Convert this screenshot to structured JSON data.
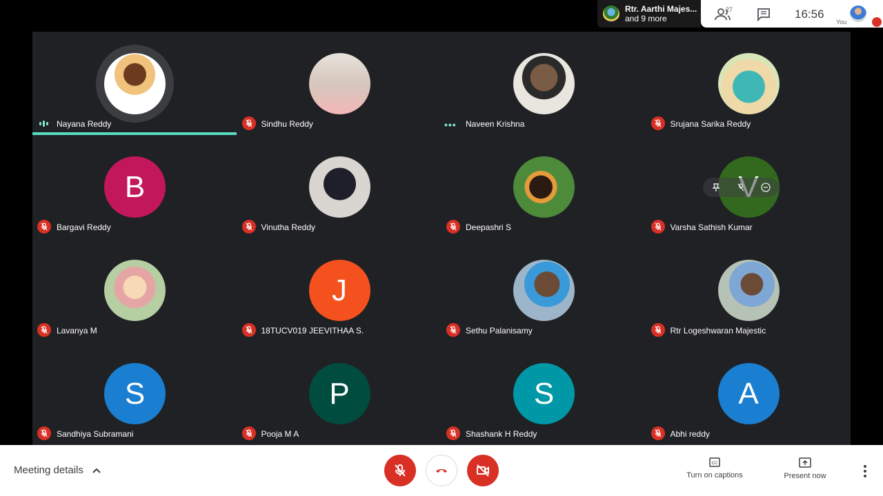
{
  "topbar": {
    "presenter_name": "Rtr. Aarthi Majes...",
    "presenter_more": "and 9 more",
    "people_count": "27",
    "clock": "16:56",
    "self_label": "You"
  },
  "participants": [
    {
      "name": "Nayana Reddy",
      "avatar": "photo",
      "status": "speaking"
    },
    {
      "name": "Sindhu Reddy",
      "avatar": "photo",
      "status": "muted"
    },
    {
      "name": "Naveen Krishna",
      "avatar": "photo",
      "status": "dots"
    },
    {
      "name": "Srujana Sarika Reddy",
      "avatar": "photo",
      "status": "muted"
    },
    {
      "name": "Bargavi Reddy",
      "avatar": "letter",
      "letter": "B",
      "color": "#c2185b",
      "status": "muted"
    },
    {
      "name": "Vinutha Reddy",
      "avatar": "photo",
      "status": "muted"
    },
    {
      "name": "Deepashri S",
      "avatar": "photo",
      "status": "muted"
    },
    {
      "name": "Varsha Sathish Kumar",
      "avatar": "letter",
      "letter": "V",
      "color": "#33691e",
      "status": "muted"
    },
    {
      "name": "Lavanya M",
      "avatar": "photo",
      "status": "muted"
    },
    {
      "name": "18TUCV019 JEEVITHAA S.",
      "avatar": "letter",
      "letter": "J",
      "color": "#f4511e",
      "status": "muted"
    },
    {
      "name": "Sethu Palanisamy",
      "avatar": "photo",
      "status": "muted"
    },
    {
      "name": "Rtr Logeshwaran Majestic",
      "avatar": "photo",
      "status": "muted"
    },
    {
      "name": "Sandhiya Subramani",
      "avatar": "letter",
      "letter": "S",
      "color": "#1a7fd1",
      "status": "muted"
    },
    {
      "name": "Pooja M A",
      "avatar": "letter",
      "letter": "P",
      "color": "#004d40",
      "status": "muted"
    },
    {
      "name": "Shashank H Reddy",
      "avatar": "letter",
      "letter": "S",
      "color": "#0097a7",
      "status": "muted"
    },
    {
      "name": "Abhi reddy",
      "avatar": "letter",
      "letter": "A",
      "color": "#1a7fd1",
      "status": "muted"
    }
  ],
  "bottombar": {
    "meeting_details": "Meeting details",
    "captions_label": "Turn on captions",
    "present_label": "Present now"
  },
  "colors": {
    "muted_red": "#d93025",
    "speaking_teal": "#57dbc1",
    "grid_bg": "#202124"
  }
}
